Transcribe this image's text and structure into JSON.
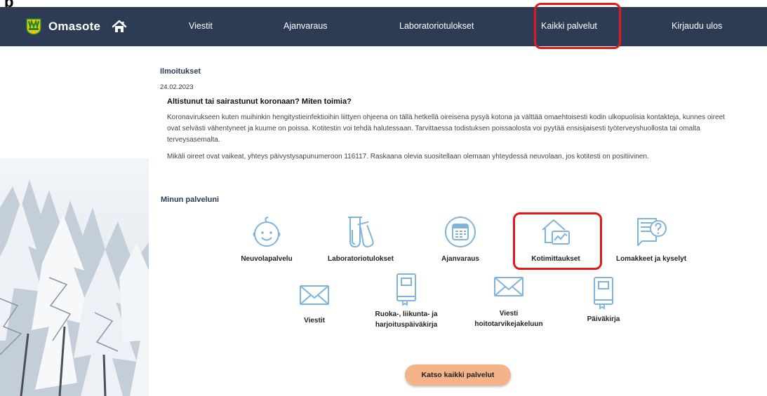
{
  "header": {
    "app_name": "Omasote",
    "nav": [
      {
        "label": "Viestit"
      },
      {
        "label": "Ajanvaraus"
      },
      {
        "label": "Laboratoriotulokset"
      },
      {
        "label": "Kaikki palvelut",
        "highlighted": true
      },
      {
        "label": "Kirjaudu ulos"
      }
    ]
  },
  "notices": {
    "title": "Ilmoitukset",
    "date": "24.02.2023",
    "headline": "Altistunut tai sairastunut koronaan? Miten toimia?",
    "paragraph1": "Koronavirukseen kuten muihinkin hengitystieinfektioihin liittyen ohjeena on tällä hetkellä oireisena pysyä kotona ja välttää omaehtoisesti kodin ulkopuolisia kontakteja, kunnes oireet ovat selvästi vähentyneet ja kuume on poissa. Kotitestin voi tehdä halutessaan. Tarvittaessa todistuksen poissaolosta voi pyytää ensisijaisesti työterveyshuollosta tai omalta terveysasemalta.",
    "paragraph2": "Mikäli oireet ovat vaikeat, yhteys päivystysapunumeroon 116117. Raskaana olevia suositellaan olemaan yhteydessä neuvolaan, jos kotitesti on positiivinen."
  },
  "services": {
    "title": "Minun palveluni",
    "items": [
      {
        "label": "Neuvolapalvelu",
        "icon": "baby-face-icon"
      },
      {
        "label": "Laboratoriotulokset",
        "icon": "test-tubes-icon"
      },
      {
        "label": "Ajanvaraus",
        "icon": "calendar-icon"
      },
      {
        "label": "Kotimittaukset",
        "icon": "home-chart-icon",
        "highlighted": true
      },
      {
        "label": "Lomakkeet ja kyselyt",
        "icon": "form-question-icon"
      },
      {
        "label": "Viestit",
        "icon": "envelope-icon"
      },
      {
        "label_line1": "Ruoka-, liikunta- ja",
        "label_line2": "harjoituspäiväkirja",
        "icon": "diary-icon"
      },
      {
        "label_line1": "Viesti",
        "label_line2": "hoitotarvikejakeluun",
        "icon": "envelope-icon"
      },
      {
        "label": "Päiväkirja",
        "icon": "diary-icon"
      }
    ],
    "all_services_label": "Katso kaikki palvelut"
  },
  "colors": {
    "header_bg": "#2d3b55",
    "icon_blue": "#7fb3d9",
    "highlight_red": "#e01a1a",
    "cta_orange": "#f5b38a"
  }
}
